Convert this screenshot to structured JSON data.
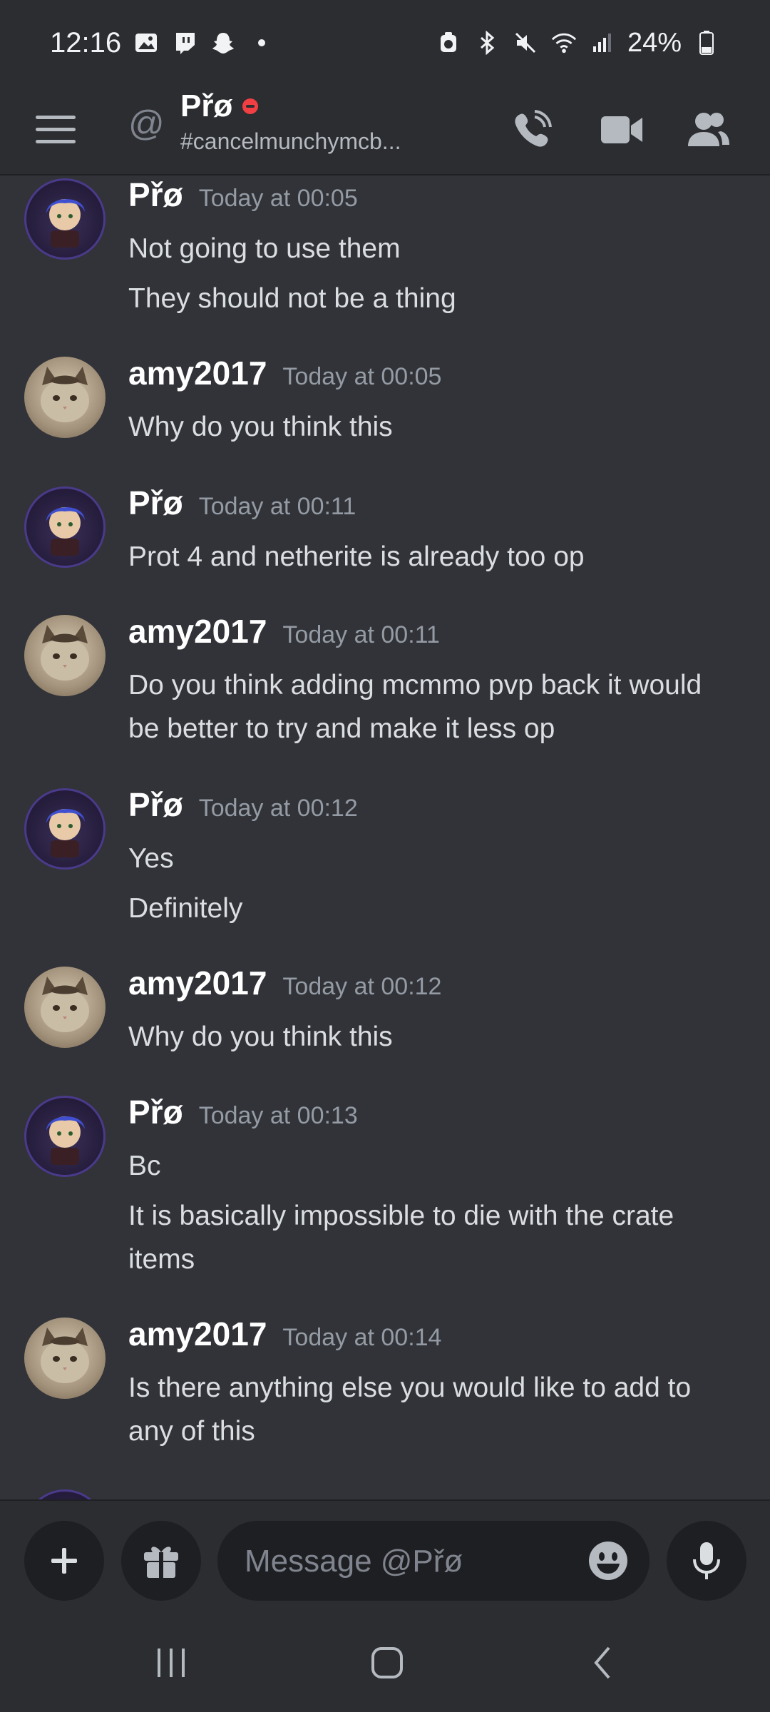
{
  "status_bar": {
    "time": "12:16",
    "battery_pct": "24%",
    "left_icons": [
      "gallery-icon",
      "twitch-icon",
      "snapchat-icon",
      "dot-icon"
    ],
    "right_icons": [
      "alarm-icon",
      "bluetooth-icon",
      "mute-icon",
      "wifi-icon",
      "signal-icon",
      "battery-icon"
    ]
  },
  "header": {
    "at_symbol": "@",
    "name": "Přø",
    "status": "#cancelmunchymcb...",
    "status_color": "#f23f43",
    "actions": [
      "call-icon",
      "video-icon",
      "members-icon"
    ]
  },
  "messages": [
    {
      "author": "Přø",
      "avatar": "pro",
      "time": "Today at 00:05",
      "lines": [
        "Not going to use them",
        "They should not be a thing"
      ]
    },
    {
      "author": "amy2017",
      "avatar": "amy",
      "time": "Today at 00:05",
      "lines": [
        "Why do you think this"
      ]
    },
    {
      "author": "Přø",
      "avatar": "pro",
      "time": "Today at 00:11",
      "lines": [
        "Prot 4 and netherite is already too op"
      ]
    },
    {
      "author": "amy2017",
      "avatar": "amy",
      "time": "Today at 00:11",
      "lines": [
        "Do you think adding mcmmo pvp back it would",
        "be better to try and make it less op"
      ]
    },
    {
      "author": "Přø",
      "avatar": "pro",
      "time": "Today at 00:12",
      "lines": [
        "Yes",
        "Definitely"
      ]
    },
    {
      "author": "amy2017",
      "avatar": "amy",
      "time": "Today at 00:12",
      "lines": [
        "Why do you think this"
      ]
    },
    {
      "author": "Přø",
      "avatar": "pro",
      "time": "Today at 00:13",
      "lines": [
        "Bc",
        "It is basically impossible to die with the crate",
        "items"
      ]
    },
    {
      "author": "amy2017",
      "avatar": "amy",
      "time": "Today at 00:14",
      "lines": [
        "Is there anything else you would like to add to",
        "any of this"
      ]
    }
  ],
  "composer": {
    "placeholder": "Message @Přø",
    "buttons": [
      "plus-icon",
      "gift-icon",
      "emoji-icon",
      "mic-icon"
    ]
  },
  "nav_bar": {
    "buttons": [
      "recents-icon",
      "home-icon",
      "back-icon"
    ]
  },
  "colors": {
    "background": "#313338",
    "bars": "#2b2d31",
    "input": "#1e1f22",
    "muted_text": "#949ba4"
  }
}
